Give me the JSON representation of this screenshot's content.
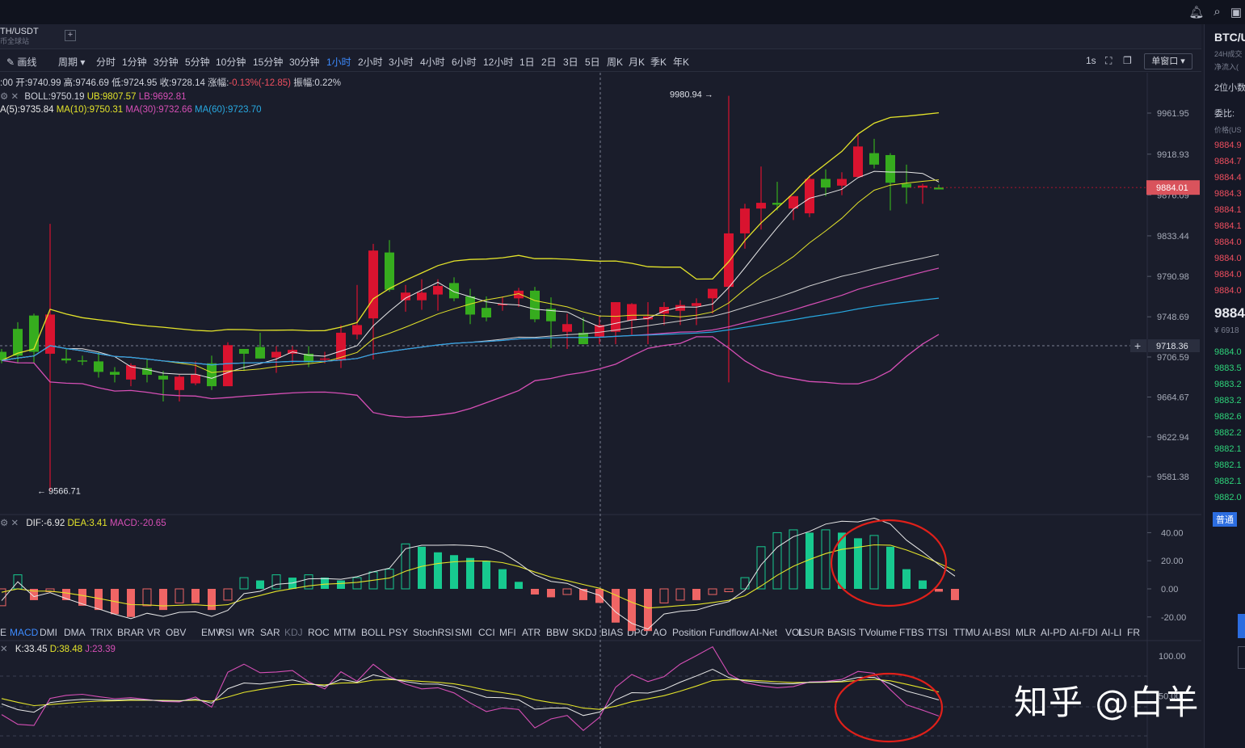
{
  "header": {
    "pair": "TH/USDT",
    "pair_sub": "币全球站",
    "top_icons": [
      "bell-icon",
      "search-icon",
      "window-icon"
    ]
  },
  "toolbar": {
    "draw_label": "画线",
    "period_label": "周期",
    "intervals": [
      "分时",
      "1分钟",
      "3分钟",
      "5分钟",
      "10分钟",
      "15分钟",
      "30分钟",
      "1小时",
      "2小时",
      "3小时",
      "4小时",
      "6小时",
      "12小时",
      "1日",
      "2日",
      "3日",
      "5日",
      "周K",
      "月K",
      "季K",
      "年K"
    ],
    "active_interval": "1小时",
    "right_label": "1s",
    "window_mode": "单窗口"
  },
  "ohlc_line": {
    "time": ":00",
    "open": "开:9740.99",
    "high": "高:9746.69",
    "low": "低:9724.95",
    "close": "收:9728.14",
    "change_label": "涨幅:",
    "change": "-0.13%(-12.85)",
    "amplitude": "振幅:0.22%"
  },
  "boll_line": {
    "boll": "BOLL:9750.19",
    "ub": "UB:9807.57",
    "lb": "LB:9692.81"
  },
  "ma_line": {
    "ma5": "A(5):9735.84",
    "ma10": "MA(10):9750.31",
    "ma30": "MA(30):9732.66",
    "ma60": "MA(60):9723.70"
  },
  "macd_line": {
    "dif": "DIF:-6.92",
    "dea": "DEA:3.41",
    "macd": "MACD:-20.65"
  },
  "kdj_line": {
    "k": "K:33.45",
    "d": "D:38.48",
    "j": "J:23.39"
  },
  "indicators": [
    "E",
    "MACD",
    "DMI",
    "DMA",
    "TRIX",
    "BRAR",
    "VR",
    "OBV",
    "EMV",
    "RSI",
    "WR",
    "SAR",
    "KDJ",
    "ROC",
    "MTM",
    "BOLL",
    "PSY",
    "StochRSI",
    "SMI",
    "CCI",
    "MFI",
    "ATR",
    "BBW",
    "SKDJ",
    "BIAS",
    "DPO",
    "AO",
    "Position",
    "Fundflow",
    "AI-Net",
    "VOL",
    "LSUR",
    "BASIS",
    "TVolume",
    "FTBS",
    "TTSI",
    "TTMU",
    "AI-BSI",
    "MLR",
    "AI-PD",
    "AI-FDI",
    "AI-LI",
    "FR"
  ],
  "active_indicator": "MACD",
  "dim_indicator": "KDJ",
  "right_panel": {
    "title": "BTC/U",
    "vol_label": "24H成交",
    "inflow_label": "净流入(",
    "precision": "2位小数",
    "ratio_label": "委比:",
    "price_label": "价格(US",
    "asks": [
      "9884.9",
      "9884.7",
      "9884.4",
      "9884.3",
      "9884.1",
      "9884.1",
      "9884.0",
      "9884.0",
      "9884.0",
      "9884.0"
    ],
    "last_price": "9884",
    "cny": "¥ 6918",
    "bids": [
      "9884.0",
      "9883.5",
      "9883.2",
      "9883.2",
      "9882.6",
      "9882.2",
      "9882.1",
      "9882.1",
      "9882.1",
      "9882.0"
    ],
    "normal_btn": "普通"
  },
  "watermark": "知乎 @白羊",
  "colors": {
    "up": "#d9132f",
    "down": "#36ac1e",
    "macd_pos": "#17c98f",
    "macd_neg": "#ef6565",
    "ub": "#e3e32a",
    "lb": "#d64fb6",
    "mid": "#d0d0d0",
    "ma60": "#28a8e0"
  },
  "chart_data": {
    "type": "candlestick",
    "price_axis": {
      "ticks": [
        9961.95,
        9918.93,
        9876.09,
        9833.44,
        9790.98,
        9748.69,
        9706.59,
        9664.67,
        9622.94,
        9581.38
      ],
      "last_price_label": "9884.01",
      "crosshair_price_label": "9718.36"
    },
    "annotations": {
      "high_label": "9980.94",
      "low_label": "9566.71"
    },
    "candles": [
      [
        9712,
        9715,
        9700,
        9703
      ],
      [
        9736,
        9743,
        9700,
        9708
      ],
      [
        9750,
        9752,
        9700,
        9712
      ],
      [
        9710,
        9846,
        9566,
        9751
      ],
      [
        9705,
        9715,
        9700,
        9703
      ],
      [
        9703,
        9708,
        9698,
        9702
      ],
      [
        9702,
        9712,
        9685,
        9691
      ],
      [
        9691,
        9696,
        9680,
        9688
      ],
      [
        9683,
        9700,
        9676,
        9698
      ],
      [
        9695,
        9704,
        9680,
        9688
      ],
      [
        9687,
        9692,
        9660,
        9683
      ],
      [
        9672,
        9688,
        9660,
        9686
      ],
      [
        9679,
        9702,
        9677,
        9688
      ],
      [
        9700,
        9708,
        9672,
        9676
      ],
      [
        9676,
        9722,
        9678,
        9719
      ],
      [
        9715,
        9715,
        9692,
        9710
      ],
      [
        9717,
        9732,
        9705,
        9705
      ],
      [
        9706,
        9718,
        9690,
        9712
      ],
      [
        9710,
        9718,
        9700,
        9714
      ],
      [
        9710,
        9718,
        9696,
        9701
      ],
      [
        9704,
        9712,
        9700,
        9705
      ],
      [
        9703,
        9740,
        9695,
        9732
      ],
      [
        9730,
        9782,
        9725,
        9740
      ],
      [
        9747,
        9825,
        9704,
        9818
      ],
      [
        9816,
        9829,
        9775,
        9777
      ],
      [
        9766,
        9782,
        9754,
        9774
      ],
      [
        9766,
        9788,
        9756,
        9774
      ],
      [
        9772,
        9788,
        9755,
        9781
      ],
      [
        9784,
        9790,
        9765,
        9768
      ],
      [
        9770,
        9778,
        9741,
        9751
      ],
      [
        9758,
        9770,
        9744,
        9748
      ],
      [
        9762,
        9770,
        9755,
        9762
      ],
      [
        9768,
        9779,
        9759,
        9776
      ],
      [
        9776,
        9780,
        9743,
        9746
      ],
      [
        9757,
        9769,
        9716,
        9744
      ],
      [
        9733,
        9752,
        9715,
        9741
      ],
      [
        9732,
        9748,
        9720,
        9720
      ],
      [
        9728,
        9750,
        9720,
        9740
      ],
      [
        9733,
        9764,
        9720,
        9764
      ],
      [
        9745,
        9763,
        9730,
        9762
      ],
      [
        9746,
        9764,
        9720,
        9749
      ],
      [
        9752,
        9764,
        9740,
        9759
      ],
      [
        9755,
        9766,
        9740,
        9761
      ],
      [
        9760,
        9768,
        9740,
        9763
      ],
      [
        9768,
        9778,
        9752,
        9778
      ],
      [
        9780,
        9980,
        9680,
        9836
      ],
      [
        9836,
        9867,
        9820,
        9862
      ],
      [
        9862,
        9906,
        9840,
        9868
      ],
      [
        9868,
        9890,
        9860,
        9866
      ],
      [
        9862,
        9875,
        9850,
        9875
      ],
      [
        9857,
        9897,
        9853,
        9893
      ],
      [
        9893,
        9903,
        9875,
        9884
      ],
      [
        9886,
        9900,
        9876,
        9893
      ],
      [
        9895,
        9940,
        9895,
        9927
      ],
      [
        9920,
        9935,
        9904,
        9908
      ],
      [
        9918,
        9920,
        9860,
        9889
      ],
      [
        9888,
        9908,
        9867,
        9884
      ],
      [
        9884,
        9888,
        9867,
        9886
      ],
      [
        9884,
        9887,
        9882,
        9882
      ]
    ],
    "macd_hist": [
      -12,
      10,
      -8,
      -2,
      -8,
      -12,
      -15,
      -18,
      -20,
      -12,
      -15,
      -10,
      -10,
      -15,
      -8,
      8,
      6,
      10,
      8,
      10,
      8,
      6,
      8,
      12,
      14,
      32,
      30,
      26,
      24,
      22,
      20,
      14,
      5,
      -4,
      -6,
      -4,
      -8,
      -10,
      -24,
      -30,
      -30,
      -10,
      -8,
      -8,
      -4,
      -2,
      8,
      30,
      40,
      42,
      40,
      42,
      40,
      36,
      38,
      30,
      14,
      6,
      -2,
      -8
    ]
  }
}
